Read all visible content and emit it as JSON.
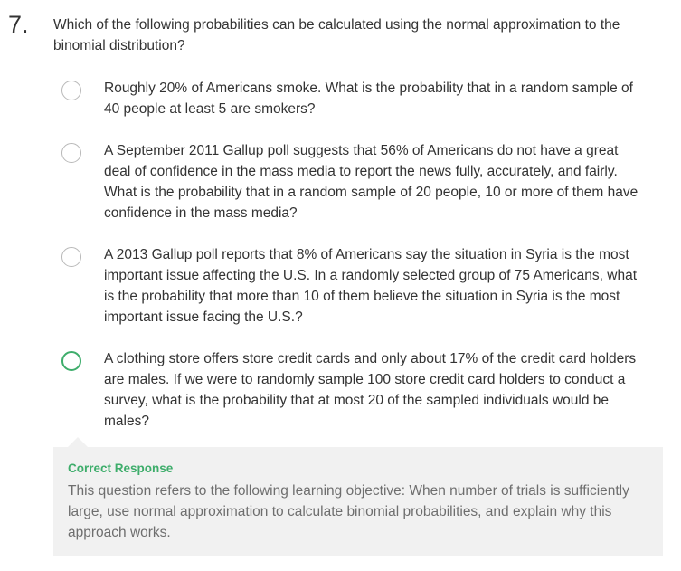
{
  "question": {
    "number": "7.",
    "text": "Which of the following probabilities can be calculated using the normal approximation to the binomial distribution?"
  },
  "options": [
    {
      "text": "Roughly 20% of Americans smoke. What is the probability that in a random sample of 40 people at least 5 are smokers?",
      "state": "unselected"
    },
    {
      "text": "A September 2011 Gallup poll suggests that 56% of Americans do not have a great deal of confidence in the mass media to report the news fully, accurately, and fairly. What is the probability that in a random sample of 20 people, 10 or more of them have confidence in the mass media?",
      "state": "unselected"
    },
    {
      "text": "A 2013 Gallup poll reports that 8% of Americans say the situation in Syria is the most important issue affecting the U.S. In a randomly selected group of 75 Americans, what is the probability that more than 10 of them believe the situation in Syria is the most important issue facing the U.S.?",
      "state": "unselected"
    },
    {
      "text": "A clothing store offers store credit cards and only about 17% of the credit card holders are males. If we were to randomly sample 100 store credit card holders to conduct a survey, what is the probability that at most 20 of the sampled individuals would be males?",
      "state": "correct"
    }
  ],
  "feedback": {
    "title": "Correct Response",
    "text": "This question refers to the following learning objective: When number of trials is sufficiently large, use normal approximation to calculate binomial probabilities, and explain why this approach works."
  },
  "colors": {
    "accent_green": "#3ead6b",
    "radio_border": "#b8b8b8",
    "feedback_bg": "#f1f1f1",
    "body_text": "#333333",
    "muted_text": "#6e6e6e"
  }
}
